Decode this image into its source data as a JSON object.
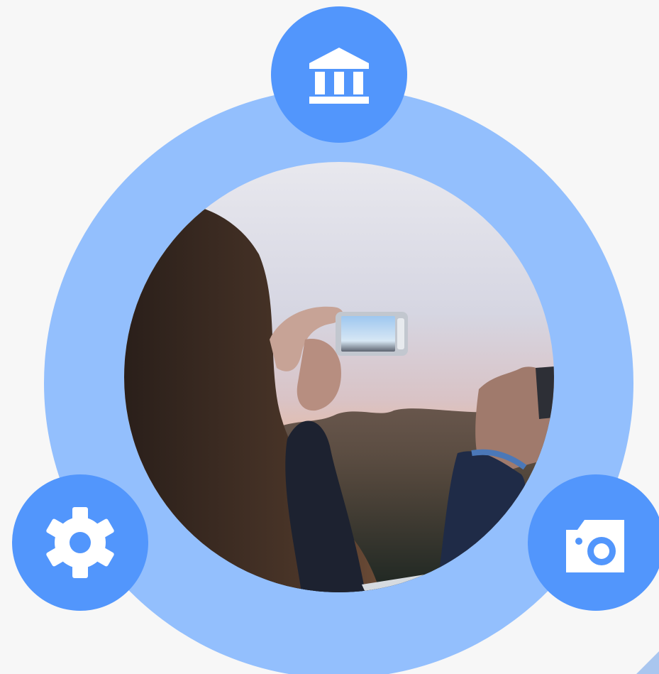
{
  "colors": {
    "background": "#f7f7f7",
    "ring": "#93bffd",
    "node": "#5296fc",
    "icon": "#ffffff"
  },
  "nodes": [
    {
      "icon": "bank-icon",
      "position": "top"
    },
    {
      "icon": "gear-icon",
      "position": "bottom-left"
    },
    {
      "icon": "camera-icon",
      "position": "bottom-right"
    }
  ],
  "center_image": {
    "subject": "photo",
    "shape": "circle"
  }
}
